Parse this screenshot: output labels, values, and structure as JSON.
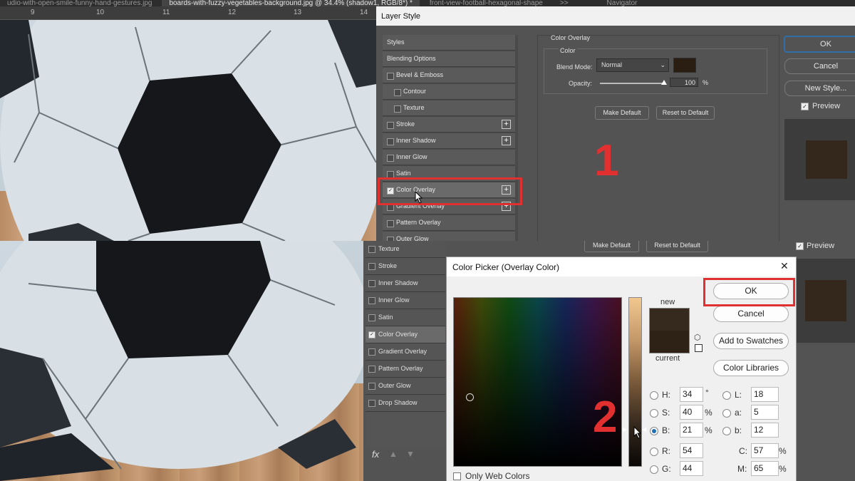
{
  "tabs": [
    "udio-with-open-smile-funny-hand-gestures.jpg",
    "boards-with-fuzzy-vegetables-background.jpg @ 34.4% (shadow1, RGB/8*) *",
    "front-view-football-hexagonal-shape",
    ">>",
    "Navigator"
  ],
  "ruler_ticks": [
    "9",
    "10",
    "11",
    "12",
    "13",
    "14"
  ],
  "layer_style": {
    "title": "Layer Style",
    "list": [
      {
        "label": "Styles",
        "checkbox": false,
        "plus": false,
        "indent": false,
        "checked": false
      },
      {
        "label": "Blending Options",
        "checkbox": false,
        "plus": false,
        "indent": false,
        "checked": false
      },
      {
        "label": "Bevel & Emboss",
        "checkbox": true,
        "plus": false,
        "indent": false,
        "checked": false
      },
      {
        "label": "Contour",
        "checkbox": true,
        "plus": false,
        "indent": true,
        "checked": false
      },
      {
        "label": "Texture",
        "checkbox": true,
        "plus": false,
        "indent": true,
        "checked": false
      },
      {
        "label": "Stroke",
        "checkbox": true,
        "plus": true,
        "indent": false,
        "checked": false
      },
      {
        "label": "Inner Shadow",
        "checkbox": true,
        "plus": true,
        "indent": false,
        "checked": false
      },
      {
        "label": "Inner Glow",
        "checkbox": true,
        "plus": false,
        "indent": false,
        "checked": false
      },
      {
        "label": "Satin",
        "checkbox": true,
        "plus": false,
        "indent": false,
        "checked": false
      },
      {
        "label": "Color Overlay",
        "checkbox": true,
        "plus": true,
        "indent": false,
        "checked": true
      },
      {
        "label": "Gradient Overlay",
        "checkbox": true,
        "plus": true,
        "indent": false,
        "checked": false
      },
      {
        "label": "Pattern Overlay",
        "checkbox": true,
        "plus": false,
        "indent": false,
        "checked": false
      },
      {
        "label": "Outer Glow",
        "checkbox": true,
        "plus": false,
        "indent": false,
        "checked": false
      }
    ],
    "section_title": "Color Overlay",
    "group_title": "Color",
    "blend_mode_label": "Blend Mode:",
    "blend_mode_value": "Normal",
    "overlay_color": "#2a1d12",
    "opacity_label": "Opacity:",
    "opacity_value": "100",
    "opacity_unit": "%",
    "make_default": "Make Default",
    "reset_default": "Reset to Default",
    "ok": "OK",
    "cancel": "Cancel",
    "new_style": "New Style...",
    "preview": "Preview",
    "preview_color": "#34281c"
  },
  "step1": "1",
  "step2": "2",
  "bottom_panel": {
    "items": [
      {
        "label": "Texture",
        "checked": false
      },
      {
        "label": "Stroke",
        "checked": false
      },
      {
        "label": "Inner Shadow",
        "checked": false
      },
      {
        "label": "Inner Glow",
        "checked": false
      },
      {
        "label": "Satin",
        "checked": false
      },
      {
        "label": "Color Overlay",
        "checked": true
      },
      {
        "label": "Gradient Overlay",
        "checked": false
      },
      {
        "label": "Pattern Overlay",
        "checked": false
      },
      {
        "label": "Outer Glow",
        "checked": false
      },
      {
        "label": "Drop Shadow",
        "checked": false
      }
    ],
    "fx": "fx",
    "make_default": "Make Default",
    "reset_default": "Reset to Default",
    "preview": "Preview"
  },
  "color_picker": {
    "title": "Color Picker (Overlay Color)",
    "close": "✕",
    "new_label": "new",
    "current_label": "current",
    "new_color": "#36291d",
    "current_color": "#2e2116",
    "ok": "OK",
    "cancel": "Cancel",
    "add_to_swatches": "Add to Swatches",
    "color_libraries": "Color Libraries",
    "only_web_colors": "Only Web Colors",
    "fields": {
      "H": {
        "label": "H:",
        "value": "34",
        "unit": "°"
      },
      "S": {
        "label": "S:",
        "value": "40",
        "unit": "%"
      },
      "B": {
        "label": "B:",
        "value": "21",
        "unit": "%"
      },
      "R": {
        "label": "R:",
        "value": "54",
        "unit": ""
      },
      "G": {
        "label": "G:",
        "value": "44",
        "unit": ""
      },
      "L": {
        "label": "L:",
        "value": "18",
        "unit": ""
      },
      "a": {
        "label": "a:",
        "value": "5",
        "unit": ""
      },
      "b": {
        "label": "b:",
        "value": "12",
        "unit": ""
      },
      "C": {
        "label": "C:",
        "value": "57",
        "unit": "%"
      },
      "M": {
        "label": "M:",
        "value": "65",
        "unit": "%"
      }
    }
  },
  "colors": {
    "accent_red": "#e23030",
    "ps_panel": "#535353",
    "ps_dark": "#3a3a3a"
  }
}
